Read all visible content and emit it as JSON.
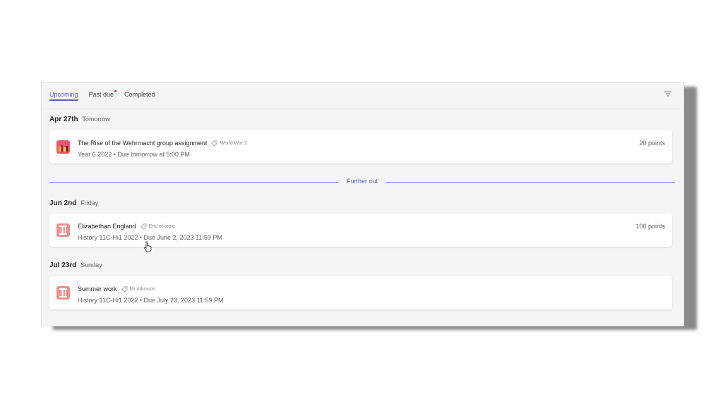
{
  "tabs": [
    {
      "label": "Upcoming",
      "active": true
    },
    {
      "label": "Past due",
      "has_alert": true
    },
    {
      "label": "Completed"
    }
  ],
  "filter_icon": "filter-icon",
  "groups": [
    {
      "date": "Apr 27th",
      "day": "Tomorrow",
      "assignments": [
        {
          "title": "The Rise of the Wehrmacht group assignment",
          "tag": "World War 2",
          "meta": "Year 6 2022 • Due tomorrow at 5:00 PM",
          "points": "20 points",
          "thumb_icon": "class-thumbnail-icon",
          "thumb_color": "#e8576a"
        }
      ]
    },
    {
      "date": "Jun 2nd",
      "day": "Friday",
      "assignments": [
        {
          "title": "Elizabethan England",
          "tag": "End of topic",
          "meta": "History 11C-Hi1 2022 • Due June 2, 2023 11:59 PM",
          "points": "100 points",
          "thumb_icon": "column-icon",
          "thumb_color": "#ec8f8f"
        }
      ]
    },
    {
      "date": "Jul 23rd",
      "day": "Sunday",
      "assignments": [
        {
          "title": "Summer work",
          "tag": "Mr Atkinson",
          "meta": "History 11C-Hi1 2022 • Due July 23, 2023 11:59 PM",
          "points": "",
          "thumb_icon": "column-icon",
          "thumb_color": "#ec8f8f"
        }
      ]
    }
  ],
  "further_out_label": "Further out",
  "colors": {
    "accent": "#5b5fc7",
    "alert": "#c4314b",
    "divider": "#7f85f5"
  }
}
